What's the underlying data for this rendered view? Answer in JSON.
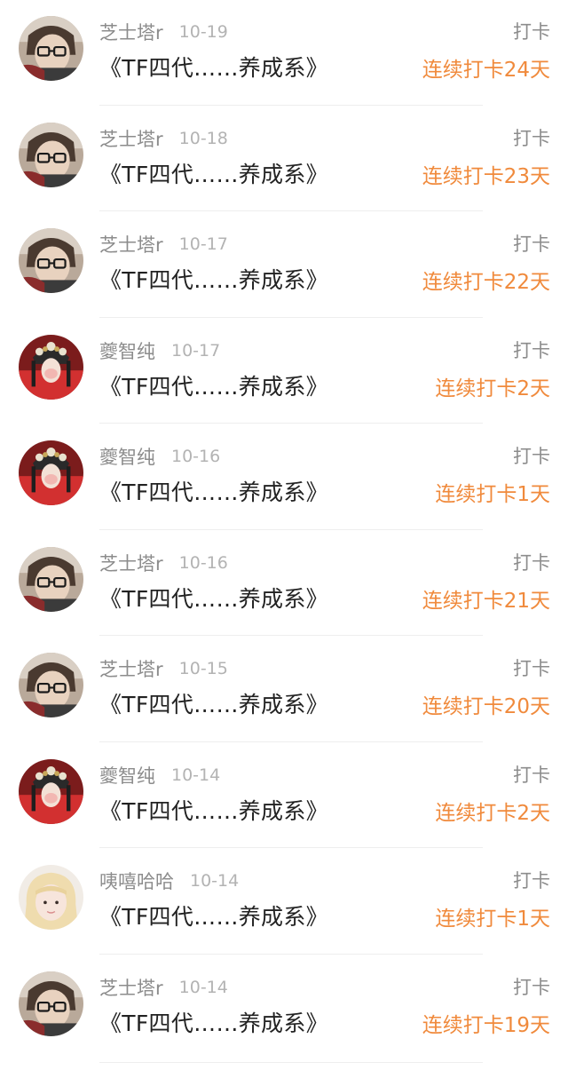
{
  "colors": {
    "username": "#8c8c8c",
    "date": "#b3b3b3",
    "title": "#222222",
    "streak": "#f08a3c",
    "divider": "#eeeeee"
  },
  "records": [
    {
      "avatar": "man-with-glasses-avatar",
      "user": "芝士塔r",
      "date": "10-19",
      "title": "《TF四代……养成系》",
      "type": "打卡",
      "streak": "连续打卡24天"
    },
    {
      "avatar": "man-with-glasses-avatar",
      "user": "芝士塔r",
      "date": "10-18",
      "title": "《TF四代……养成系》",
      "type": "打卡",
      "streak": "连续打卡23天"
    },
    {
      "avatar": "man-with-glasses-avatar",
      "user": "芝士塔r",
      "date": "10-17",
      "title": "《TF四代……养成系》",
      "type": "打卡",
      "streak": "连续打卡22天"
    },
    {
      "avatar": "opera-performer-avatar",
      "user": "夔智纯",
      "date": "10-17",
      "title": "《TF四代……养成系》",
      "type": "打卡",
      "streak": "连续打卡2天"
    },
    {
      "avatar": "opera-performer-avatar",
      "user": "夔智纯",
      "date": "10-16",
      "title": "《TF四代……养成系》",
      "type": "打卡",
      "streak": "连续打卡1天"
    },
    {
      "avatar": "man-with-glasses-avatar",
      "user": "芝士塔r",
      "date": "10-16",
      "title": "《TF四代……养成系》",
      "type": "打卡",
      "streak": "连续打卡21天"
    },
    {
      "avatar": "man-with-glasses-avatar",
      "user": "芝士塔r",
      "date": "10-15",
      "title": "《TF四代……养成系》",
      "type": "打卡",
      "streak": "连续打卡20天"
    },
    {
      "avatar": "opera-performer-avatar",
      "user": "夔智纯",
      "date": "10-14",
      "title": "《TF四代……养成系》",
      "type": "打卡",
      "streak": "连续打卡2天"
    },
    {
      "avatar": "blonde-girl-avatar",
      "user": "咦嘻哈哈",
      "date": "10-14",
      "title": "《TF四代……养成系》",
      "type": "打卡",
      "streak": "连续打卡1天"
    },
    {
      "avatar": "man-with-glasses-avatar",
      "user": "芝士塔r",
      "date": "10-14",
      "title": "《TF四代……养成系》",
      "type": "打卡",
      "streak": "连续打卡19天"
    }
  ]
}
